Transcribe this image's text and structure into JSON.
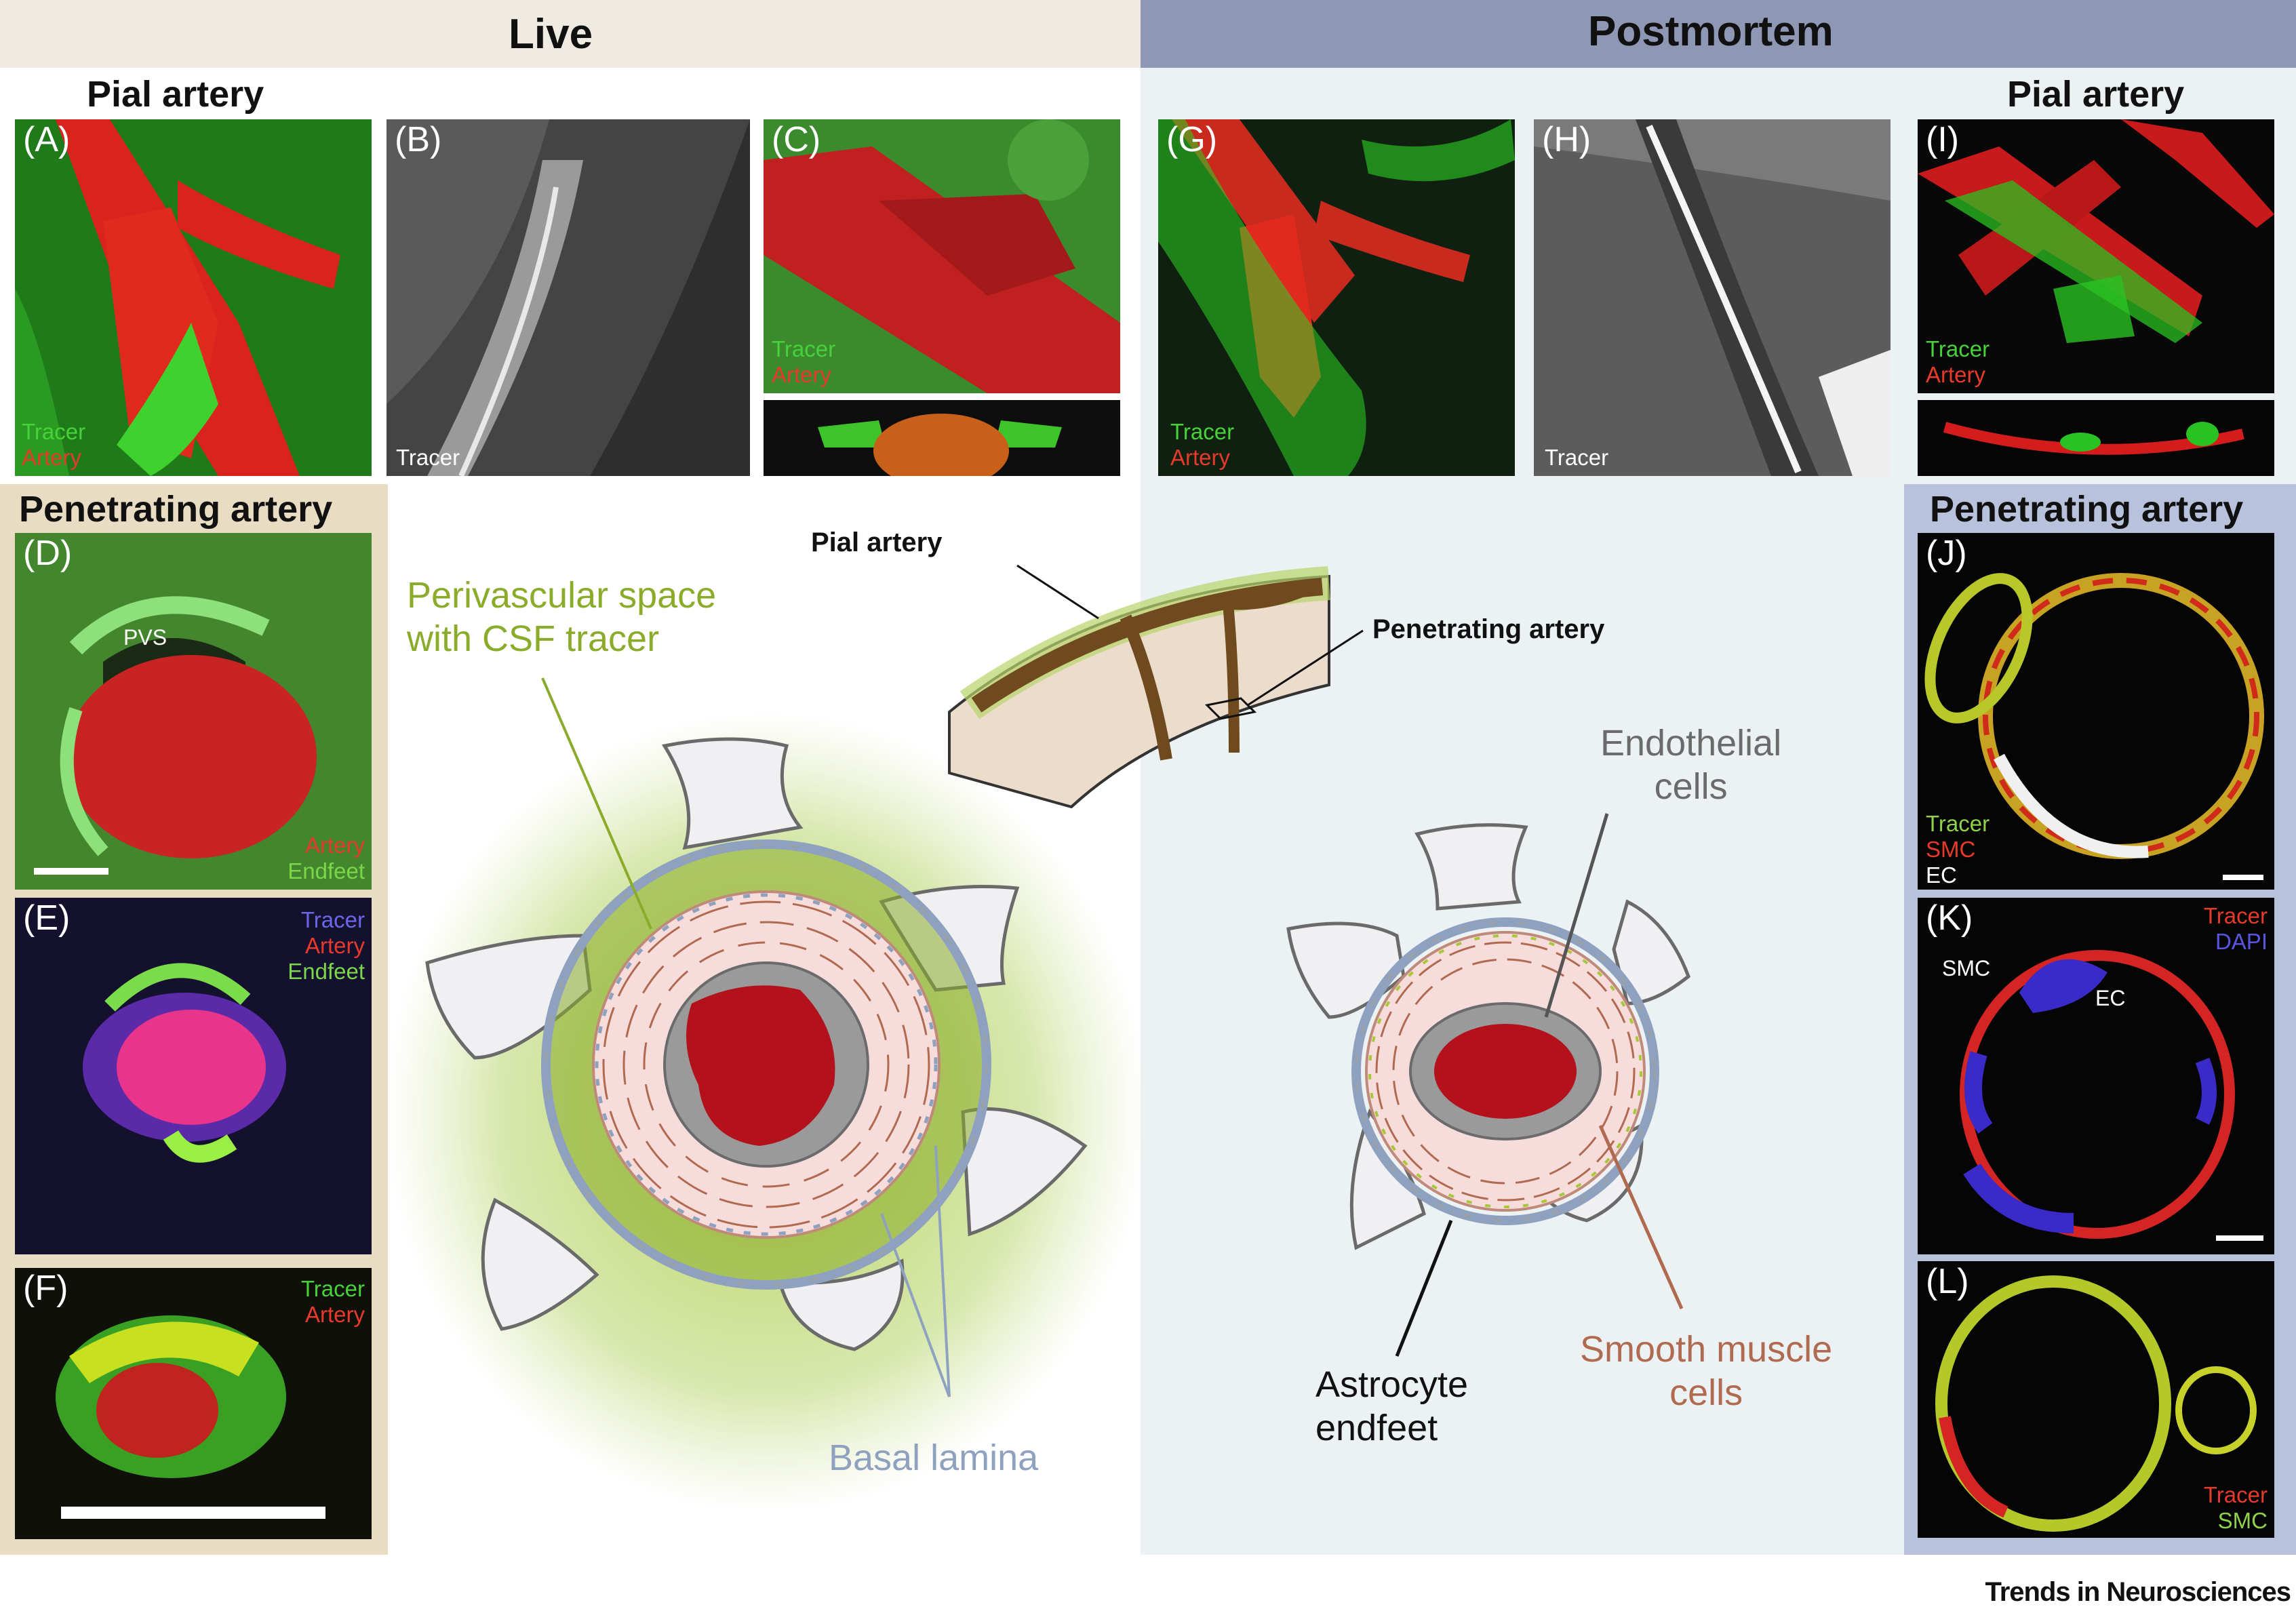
{
  "headers": {
    "live": "Live",
    "postmortem": "Postmortem"
  },
  "sections": {
    "pial_left": "Pial artery",
    "pial_right": "Pial artery",
    "pen_left": "Penetrating artery",
    "pen_right": "Penetrating artery"
  },
  "panels": {
    "A": {
      "label": "(A)",
      "legend": [
        "Tracer",
        "Artery"
      ]
    },
    "B": {
      "label": "(B)",
      "legend": [
        "Tracer"
      ]
    },
    "C": {
      "label": "(C)",
      "legend": [
        "Tracer",
        "Artery"
      ]
    },
    "D": {
      "label": "(D)",
      "legend": [
        "Artery",
        "Endfeet"
      ],
      "pvs": "PVS"
    },
    "E": {
      "label": "(E)",
      "legend": [
        "Tracer",
        "Artery",
        "Endfeet"
      ]
    },
    "F": {
      "label": "(F)",
      "legend": [
        "Tracer",
        "Artery"
      ]
    },
    "G": {
      "label": "(G)",
      "legend": [
        "Tracer",
        "Artery"
      ]
    },
    "H": {
      "label": "(H)",
      "legend": [
        "Tracer"
      ]
    },
    "I": {
      "label": "(I)",
      "legend": [
        "Tracer",
        "Artery"
      ]
    },
    "J": {
      "label": "(J)",
      "legend": [
        "Tracer",
        "SMC",
        "EC"
      ]
    },
    "K": {
      "label": "(K)",
      "legend": [
        "Tracer",
        "DAPI"
      ],
      "smc": "SMC",
      "ec": "EC"
    },
    "L": {
      "label": "(L)",
      "legend": [
        "Tracer",
        "SMC"
      ]
    }
  },
  "schematic": {
    "pial_artery": "Pial artery",
    "penetrating_artery": "Penetrating artery",
    "pvs_line1": "Perivascular space",
    "pvs_line2": "with CSF tracer",
    "basal_lamina": "Basal lamina",
    "endo_line1": "Endothelial",
    "endo_line2": "cells",
    "astro_line1": "Astrocyte",
    "astro_line2": "endfeet",
    "smc_line1": "Smooth muscle",
    "smc_line2": "cells"
  },
  "footer": "Trends in Neurosciences",
  "colors": {
    "live_header": "#efebe3",
    "postmortem_header": "#8e97b3",
    "postmortem_bg": "#ecf1f3",
    "left_pen_bg": "#e8dcc3",
    "right_pen_bg": "#b9c2dc",
    "tracer_green": "#27c21f",
    "artery_red": "#d52020",
    "pvs_green": "#8aac2a",
    "basal_blue": "#8ea2c0",
    "smc_brown": "#b06a50",
    "endo_gray": "#6b6b6b"
  }
}
